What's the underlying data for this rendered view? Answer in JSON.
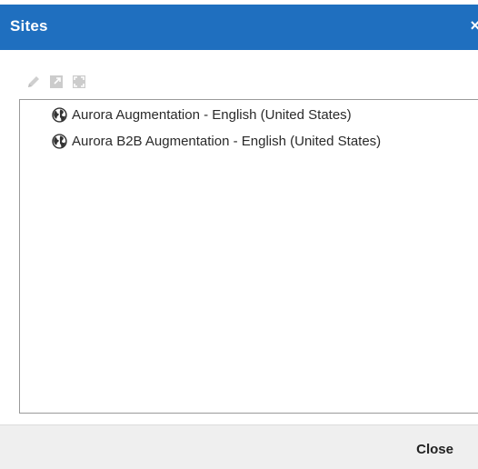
{
  "dialog": {
    "title": "Sites",
    "close_glyph": "×"
  },
  "toolbar": {
    "buttons": [
      {
        "icon": "pencil-icon",
        "enabled": false
      },
      {
        "icon": "export-icon",
        "enabled": false
      },
      {
        "icon": "expand-icon",
        "enabled": false
      }
    ]
  },
  "tree": {
    "items": [
      {
        "label": "Aurora Augmentation - English (United States)",
        "icon": "globe-icon"
      },
      {
        "label": "Aurora B2B Augmentation - English (United States)",
        "icon": "globe-icon"
      }
    ]
  },
  "footer": {
    "close_label": "Close"
  },
  "colors": {
    "titlebar": "#1f6fbf",
    "disabled_icon": "#c8c8c8"
  }
}
